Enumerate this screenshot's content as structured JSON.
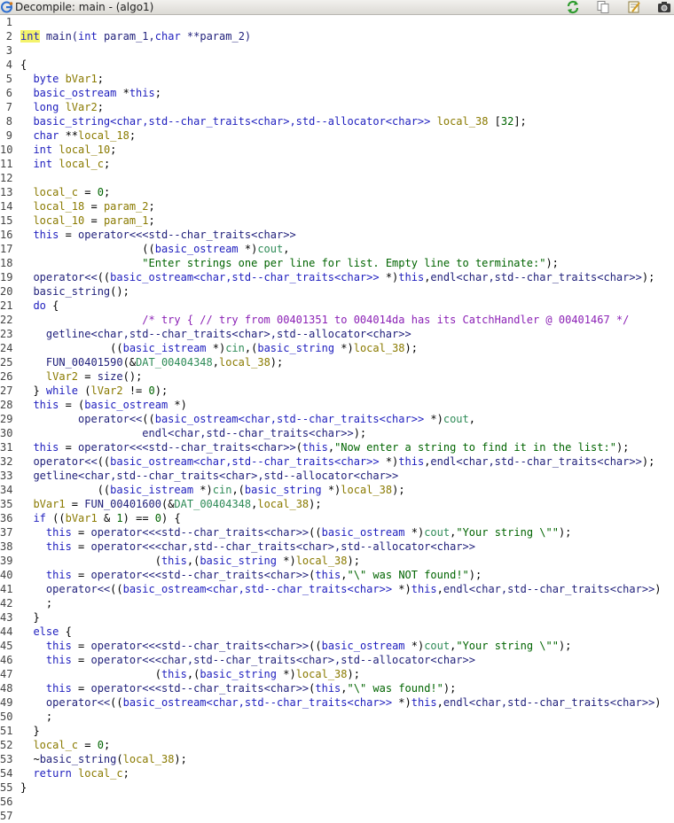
{
  "window": {
    "title": "Decompile: main -  (algo1)"
  },
  "toolbar": {
    "icons": [
      "refresh-icon",
      "copy-icon",
      "edit-icon",
      "snapshot-icon"
    ]
  },
  "colors": {
    "keyword": "#1e1ebe",
    "local_variable": "#8a7a00",
    "global": "#2e8b57",
    "string": "#006400",
    "comment": "#8b21b5",
    "highlight": "#f4f36b"
  },
  "code": [
    [],
    [
      [
        "kw hl",
        "int"
      ],
      [
        "fn",
        " main("
      ],
      [
        "kw",
        "int"
      ],
      [
        "fn",
        " param_1,"
      ],
      [
        "kw",
        "char"
      ],
      [
        "fn",
        " **param_2)"
      ]
    ],
    [],
    [
      [
        "",
        "{"
      ]
    ],
    [
      [
        "",
        "  "
      ],
      [
        "kw",
        "byte"
      ],
      [
        "var",
        " bVar1"
      ],
      [
        "",
        ";"
      ]
    ],
    [
      [
        "",
        "  "
      ],
      [
        "type",
        "basic_ostream"
      ],
      [
        "",
        " *"
      ],
      [
        "kw",
        "this"
      ],
      [
        "",
        ";"
      ]
    ],
    [
      [
        "",
        "  "
      ],
      [
        "kw",
        "long"
      ],
      [
        "var",
        " lVar2"
      ],
      [
        "",
        ";"
      ]
    ],
    [
      [
        "",
        "  "
      ],
      [
        "type",
        "basic_string<char,std--char_traits<char>,std--allocator<char>>"
      ],
      [
        "var",
        " local_38"
      ],
      [
        "",
        " ["
      ],
      [
        "num",
        "32"
      ],
      [
        "",
        "];"
      ]
    ],
    [
      [
        "",
        "  "
      ],
      [
        "kw",
        "char"
      ],
      [
        "",
        " **"
      ],
      [
        "var",
        "local_18"
      ],
      [
        "",
        ";"
      ]
    ],
    [
      [
        "",
        "  "
      ],
      [
        "kw",
        "int"
      ],
      [
        "var",
        " local_10"
      ],
      [
        "",
        ";"
      ]
    ],
    [
      [
        "",
        "  "
      ],
      [
        "kw",
        "int"
      ],
      [
        "var",
        " local_c"
      ],
      [
        "",
        ";"
      ]
    ],
    [],
    [
      [
        "",
        "  "
      ],
      [
        "var",
        "local_c"
      ],
      [
        "",
        " = "
      ],
      [
        "num",
        "0"
      ],
      [
        "",
        ";"
      ]
    ],
    [
      [
        "",
        "  "
      ],
      [
        "var",
        "local_18"
      ],
      [
        "",
        " = "
      ],
      [
        "var",
        "param_2"
      ],
      [
        "",
        ";"
      ]
    ],
    [
      [
        "",
        "  "
      ],
      [
        "var",
        "local_10"
      ],
      [
        "",
        " = "
      ],
      [
        "var",
        "param_1"
      ],
      [
        "",
        ";"
      ]
    ],
    [
      [
        "",
        "  "
      ],
      [
        "kw",
        "this"
      ],
      [
        "",
        " = "
      ],
      [
        "fn",
        "operator<<<std--char_traits<char>>"
      ]
    ],
    [
      [
        "",
        "                   (("
      ],
      [
        "type",
        "basic_ostream"
      ],
      [
        "",
        " *)"
      ],
      [
        "glob",
        "cout"
      ],
      [
        "",
        ","
      ]
    ],
    [
      [
        "",
        "                   "
      ],
      [
        "str",
        "\"Enter strings one per line for list. Empty line to terminate:\""
      ],
      [
        "",
        ");"
      ]
    ],
    [
      [
        "",
        "  "
      ],
      [
        "fn",
        "operator<<"
      ],
      [
        "",
        "(("
      ],
      [
        "type",
        "basic_ostream<char,std--char_traits<char>>"
      ],
      [
        "",
        " *)"
      ],
      [
        "kw",
        "this"
      ],
      [
        "",
        ","
      ],
      [
        "fn",
        "endl<char,std--char_traits<char>>"
      ],
      [
        "",
        ");"
      ]
    ],
    [
      [
        "",
        "  "
      ],
      [
        "fn",
        "basic_string"
      ],
      [
        "",
        "();"
      ]
    ],
    [
      [
        "",
        "  "
      ],
      [
        "kw",
        "do"
      ],
      [
        "",
        " {"
      ]
    ],
    [
      [
        "",
        "                   "
      ],
      [
        "cmt",
        "/* try { // try from 00401351 to 004014da has its CatchHandler @ 00401467 */"
      ]
    ],
    [
      [
        "",
        "    "
      ],
      [
        "fn",
        "getline<char,std--char_traits<char>,std--allocator<char>>"
      ]
    ],
    [
      [
        "",
        "              (("
      ],
      [
        "type",
        "basic_istream"
      ],
      [
        "",
        " *)"
      ],
      [
        "glob",
        "cin"
      ],
      [
        "",
        ",("
      ],
      [
        "type",
        "basic_string"
      ],
      [
        "",
        " *)"
      ],
      [
        "var",
        "local_38"
      ],
      [
        "",
        ");"
      ]
    ],
    [
      [
        "",
        "    "
      ],
      [
        "fn",
        "FUN_00401590"
      ],
      [
        "",
        "(&"
      ],
      [
        "glob",
        "DAT_00404348"
      ],
      [
        "",
        ","
      ],
      [
        "var",
        "local_38"
      ],
      [
        "",
        ");"
      ]
    ],
    [
      [
        "",
        "    "
      ],
      [
        "var",
        "lVar2"
      ],
      [
        "",
        " = "
      ],
      [
        "fn",
        "size"
      ],
      [
        "",
        "();"
      ]
    ],
    [
      [
        "",
        "  } "
      ],
      [
        "kw",
        "while"
      ],
      [
        "",
        " ("
      ],
      [
        "var",
        "lVar2"
      ],
      [
        "",
        " != "
      ],
      [
        "num",
        "0"
      ],
      [
        "",
        ");"
      ]
    ],
    [
      [
        "",
        "  "
      ],
      [
        "kw",
        "this"
      ],
      [
        "",
        " = ("
      ],
      [
        "type",
        "basic_ostream"
      ],
      [
        "",
        " *)"
      ]
    ],
    [
      [
        "",
        "         "
      ],
      [
        "fn",
        "operator<<"
      ],
      [
        "",
        "(("
      ],
      [
        "type",
        "basic_ostream<char,std--char_traits<char>>"
      ],
      [
        "",
        " *)"
      ],
      [
        "glob",
        "cout"
      ],
      [
        "",
        ","
      ]
    ],
    [
      [
        "",
        "                   "
      ],
      [
        "fn",
        "endl<char,std--char_traits<char>>"
      ],
      [
        "",
        ");"
      ]
    ],
    [
      [
        "",
        "  "
      ],
      [
        "kw",
        "this"
      ],
      [
        "",
        " = "
      ],
      [
        "fn",
        "operator<<<std--char_traits<char>>"
      ],
      [
        "",
        "("
      ],
      [
        "kw",
        "this"
      ],
      [
        "",
        ","
      ],
      [
        "str",
        "\"Now enter a string to find it in the list:\""
      ],
      [
        "",
        ");"
      ]
    ],
    [
      [
        "",
        "  "
      ],
      [
        "fn",
        "operator<<"
      ],
      [
        "",
        "(("
      ],
      [
        "type",
        "basic_ostream<char,std--char_traits<char>>"
      ],
      [
        "",
        " *)"
      ],
      [
        "kw",
        "this"
      ],
      [
        "",
        ","
      ],
      [
        "fn",
        "endl<char,std--char_traits<char>>"
      ],
      [
        "",
        ");"
      ]
    ],
    [
      [
        "",
        "  "
      ],
      [
        "fn",
        "getline<char,std--char_traits<char>,std--allocator<char>>"
      ]
    ],
    [
      [
        "",
        "            (("
      ],
      [
        "type",
        "basic_istream"
      ],
      [
        "",
        " *)"
      ],
      [
        "glob",
        "cin"
      ],
      [
        "",
        ",("
      ],
      [
        "type",
        "basic_string"
      ],
      [
        "",
        " *)"
      ],
      [
        "var",
        "local_38"
      ],
      [
        "",
        ");"
      ]
    ],
    [
      [
        "",
        "  "
      ],
      [
        "var",
        "bVar1"
      ],
      [
        "",
        " = "
      ],
      [
        "fn",
        "FUN_00401600"
      ],
      [
        "",
        "(&"
      ],
      [
        "glob",
        "DAT_00404348"
      ],
      [
        "",
        ","
      ],
      [
        "var",
        "local_38"
      ],
      [
        "",
        ");"
      ]
    ],
    [
      [
        "",
        "  "
      ],
      [
        "kw",
        "if"
      ],
      [
        "",
        " (("
      ],
      [
        "var",
        "bVar1"
      ],
      [
        "",
        " & "
      ],
      [
        "num",
        "1"
      ],
      [
        "",
        ") == "
      ],
      [
        "num",
        "0"
      ],
      [
        "",
        ") {"
      ]
    ],
    [
      [
        "",
        "    "
      ],
      [
        "kw",
        "this"
      ],
      [
        "",
        " = "
      ],
      [
        "fn",
        "operator<<<std--char_traits<char>>"
      ],
      [
        "",
        "(("
      ],
      [
        "type",
        "basic_ostream"
      ],
      [
        "",
        " *)"
      ],
      [
        "glob",
        "cout"
      ],
      [
        "",
        ","
      ],
      [
        "str",
        "\"Your string \\\"\""
      ],
      [
        "",
        ");"
      ]
    ],
    [
      [
        "",
        "    "
      ],
      [
        "kw",
        "this"
      ],
      [
        "",
        " = "
      ],
      [
        "fn",
        "operator<<<char,std--char_traits<char>,std--allocator<char>>"
      ]
    ],
    [
      [
        "",
        "                     ("
      ],
      [
        "kw",
        "this"
      ],
      [
        "",
        ",("
      ],
      [
        "type",
        "basic_string"
      ],
      [
        "",
        " *)"
      ],
      [
        "var",
        "local_38"
      ],
      [
        "",
        ");"
      ]
    ],
    [
      [
        "",
        "    "
      ],
      [
        "kw",
        "this"
      ],
      [
        "",
        " = "
      ],
      [
        "fn",
        "operator<<<std--char_traits<char>>"
      ],
      [
        "",
        "("
      ],
      [
        "kw",
        "this"
      ],
      [
        "",
        ","
      ],
      [
        "str",
        "\"\\\" was NOT found!\""
      ],
      [
        "",
        ");"
      ]
    ],
    [
      [
        "",
        "    "
      ],
      [
        "fn",
        "operator<<"
      ],
      [
        "",
        "(("
      ],
      [
        "type",
        "basic_ostream<char,std--char_traits<char>>"
      ],
      [
        "",
        " *)"
      ],
      [
        "kw",
        "this"
      ],
      [
        "",
        ","
      ],
      [
        "fn",
        "endl<char,std--char_traits<char>>"
      ],
      [
        "",
        ")"
      ]
    ],
    [
      [
        "",
        "    ;"
      ]
    ],
    [
      [
        "",
        "  }"
      ]
    ],
    [
      [
        "",
        "  "
      ],
      [
        "kw",
        "else"
      ],
      [
        "",
        " {"
      ]
    ],
    [
      [
        "",
        "    "
      ],
      [
        "kw",
        "this"
      ],
      [
        "",
        " = "
      ],
      [
        "fn",
        "operator<<<std--char_traits<char>>"
      ],
      [
        "",
        "(("
      ],
      [
        "type",
        "basic_ostream"
      ],
      [
        "",
        " *)"
      ],
      [
        "glob",
        "cout"
      ],
      [
        "",
        ","
      ],
      [
        "str",
        "\"Your string \\\"\""
      ],
      [
        "",
        ");"
      ]
    ],
    [
      [
        "",
        "    "
      ],
      [
        "kw",
        "this"
      ],
      [
        "",
        " = "
      ],
      [
        "fn",
        "operator<<<char,std--char_traits<char>,std--allocator<char>>"
      ]
    ],
    [
      [
        "",
        "                     ("
      ],
      [
        "kw",
        "this"
      ],
      [
        "",
        ",("
      ],
      [
        "type",
        "basic_string"
      ],
      [
        "",
        " *)"
      ],
      [
        "var",
        "local_38"
      ],
      [
        "",
        ");"
      ]
    ],
    [
      [
        "",
        "    "
      ],
      [
        "kw",
        "this"
      ],
      [
        "",
        " = "
      ],
      [
        "fn",
        "operator<<<std--char_traits<char>>"
      ],
      [
        "",
        "("
      ],
      [
        "kw",
        "this"
      ],
      [
        "",
        ","
      ],
      [
        "str",
        "\"\\\" was found!\""
      ],
      [
        "",
        ");"
      ]
    ],
    [
      [
        "",
        "    "
      ],
      [
        "fn",
        "operator<<"
      ],
      [
        "",
        "(("
      ],
      [
        "type",
        "basic_ostream<char,std--char_traits<char>>"
      ],
      [
        "",
        " *)"
      ],
      [
        "kw",
        "this"
      ],
      [
        "",
        ","
      ],
      [
        "fn",
        "endl<char,std--char_traits<char>>"
      ],
      [
        "",
        ")"
      ]
    ],
    [
      [
        "",
        "    ;"
      ]
    ],
    [
      [
        "",
        "  }"
      ]
    ],
    [
      [
        "",
        "  "
      ],
      [
        "var",
        "local_c"
      ],
      [
        "",
        " = "
      ],
      [
        "num",
        "0"
      ],
      [
        "",
        ";"
      ]
    ],
    [
      [
        "",
        "  ~"
      ],
      [
        "fn",
        "basic_string"
      ],
      [
        "",
        "("
      ],
      [
        "var",
        "local_38"
      ],
      [
        "",
        ");"
      ]
    ],
    [
      [
        "",
        "  "
      ],
      [
        "kw",
        "return"
      ],
      [
        "var",
        " local_c"
      ],
      [
        "",
        ";"
      ]
    ],
    [
      [
        "",
        "}"
      ]
    ],
    [],
    []
  ]
}
